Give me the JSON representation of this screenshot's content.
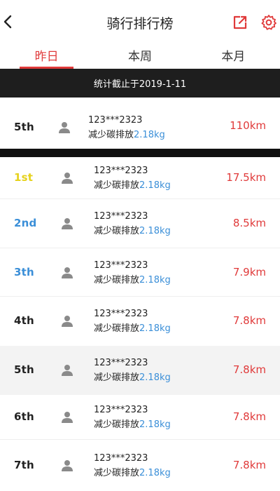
{
  "header": {
    "title": "骑行排行榜"
  },
  "tabs": [
    {
      "label": "昨日",
      "active": true
    },
    {
      "label": "本周",
      "active": false
    },
    {
      "label": "本月",
      "active": false
    }
  ],
  "stat_bar": "统计截止于2019-1-11",
  "my_rank": {
    "rank": "5th",
    "user": "123***2323",
    "carbon_label": "减少碳排放",
    "carbon_value": "2.18kg",
    "distance": "110km"
  },
  "rows": [
    {
      "rank": "1st",
      "user": "123***2323",
      "carbon_label": "减少碳排放",
      "carbon_value": "2.18kg",
      "distance": "17.5km",
      "rank_color": "#e6d21c"
    },
    {
      "rank": "2nd",
      "user": "123***2323",
      "carbon_label": "减少碳排放",
      "carbon_value": "2.18kg",
      "distance": "8.5km",
      "rank_color": "#3b8fd8"
    },
    {
      "rank": "3th",
      "user": "123***2323",
      "carbon_label": "减少碳排放",
      "carbon_value": "2.18kg",
      "distance": "7.9km",
      "rank_color": "#3b8fd8"
    },
    {
      "rank": "4th",
      "user": "123***2323",
      "carbon_label": "减少碳排放",
      "carbon_value": "2.18kg",
      "distance": "7.8km",
      "rank_color": "#222222"
    },
    {
      "rank": "5th",
      "user": "123***2323",
      "carbon_label": "减少碳排放",
      "carbon_value": "2.18kg",
      "distance": "7.8km",
      "rank_color": "#222222"
    },
    {
      "rank": "6th",
      "user": "123***2323",
      "carbon_label": "减少碳排放",
      "carbon_value": "2.18kg",
      "distance": "7.8km",
      "rank_color": "#222222"
    },
    {
      "rank": "7th",
      "user": "123***2323",
      "carbon_label": "减少碳排放",
      "carbon_value": "2.18kg",
      "distance": "7.8km",
      "rank_color": "#222222"
    }
  ],
  "colors": {
    "accent": "#e03a3a",
    "carbon_value": "#3b8fd8"
  },
  "icons": {
    "back": "chevron-left-icon",
    "share": "share-icon",
    "settings": "gear-icon",
    "avatar": "user-icon"
  }
}
